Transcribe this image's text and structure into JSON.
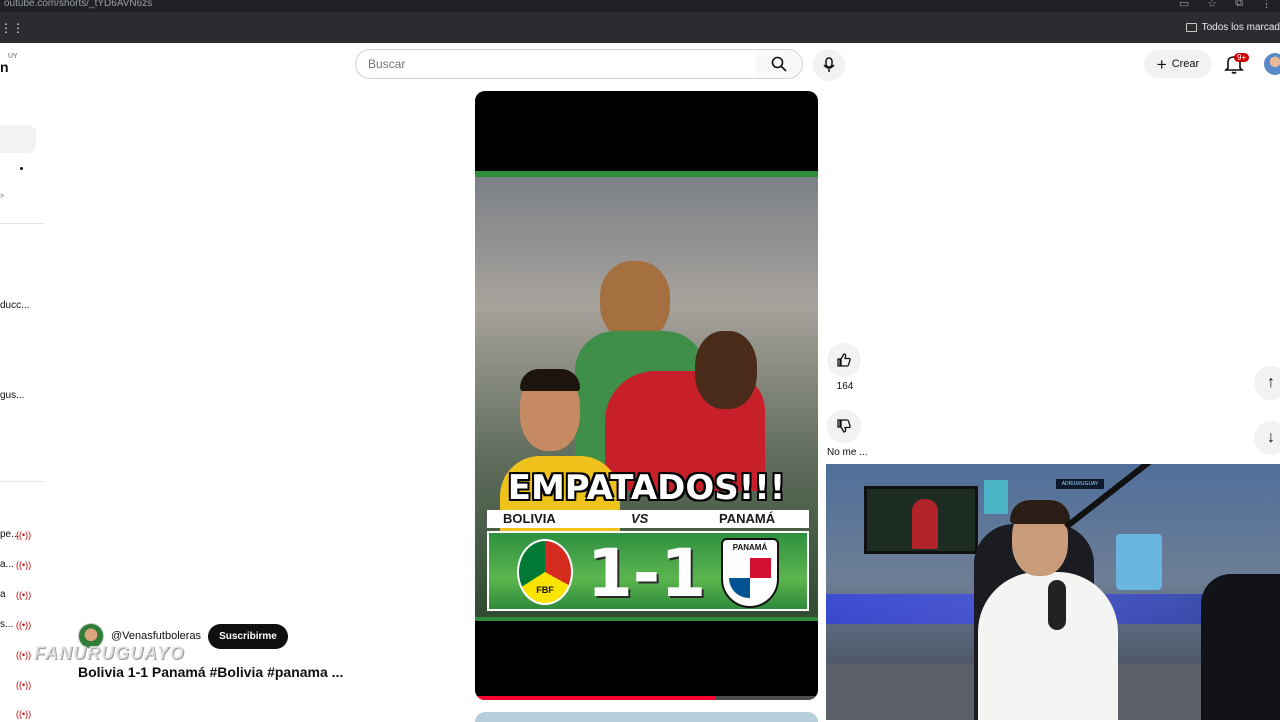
{
  "browser": {
    "url": "outube.com/shorts/_tYD6AVN6zs",
    "bookmarks_folder": "Todos los marcad"
  },
  "header": {
    "logo_fragment": "n",
    "logo_sup": "UY",
    "search_placeholder": "Buscar",
    "create_label": "Crear",
    "notification_badge": "9+"
  },
  "sidebar": {
    "items": [
      "ducc...",
      "gus..."
    ],
    "live_items": [
      "pe...",
      "a...",
      "a",
      "s...",
      "",
      "",
      ""
    ]
  },
  "short": {
    "headline": "EMPATADOS!!!",
    "team_a": "BOLIVIA",
    "vs": "VS",
    "team_b": "PANAMÁ",
    "score": "1-1",
    "crest_a_text": "FBF",
    "crest_b_text": "PANAMÁ",
    "progress": 0.7
  },
  "channel": {
    "handle": "@Venasfutboleras",
    "subscribe_label": "Suscribirme",
    "video_title": "Bolivia 1-1 Panamá #Bolivia #panama ...",
    "watermark": "FANURUGUAYO"
  },
  "actions": {
    "like_count": "164",
    "dislike_label": "No me ..."
  },
  "webcam": {
    "sign_text": "ADRIURUGUAY"
  }
}
